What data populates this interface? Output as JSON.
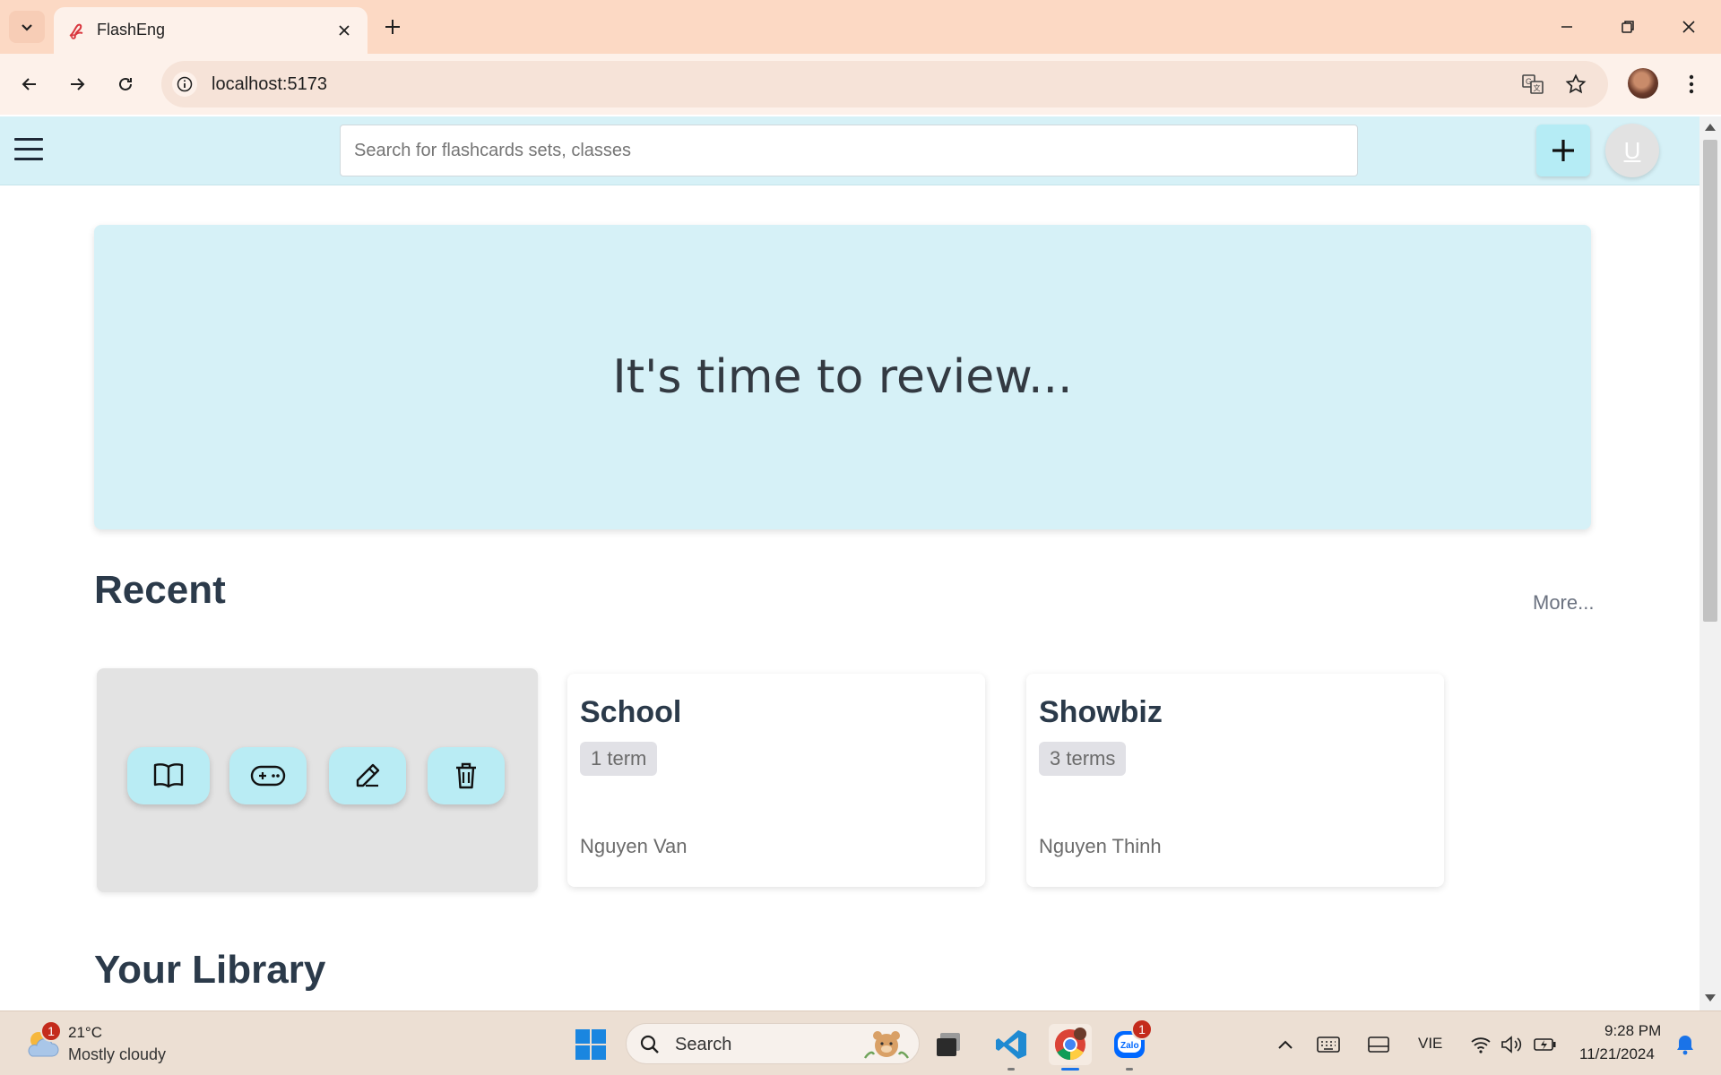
{
  "browser": {
    "tab_title": "FlashEng",
    "url": "localhost:5173"
  },
  "header": {
    "search_placeholder": "Search for flashcards sets, classes",
    "avatar_initial": "U"
  },
  "hero": {
    "text": "It's time to review..."
  },
  "recent": {
    "title": "Recent",
    "more_label": "More...",
    "sets": [
      {
        "title": "School",
        "terms": "1 term",
        "author": "Nguyen Van"
      },
      {
        "title": "Showbiz",
        "terms": "3 terms",
        "author": "Nguyen Thinh"
      }
    ]
  },
  "library": {
    "title": "Your Library"
  },
  "taskbar": {
    "weather_badge": "1",
    "temperature": "21°C",
    "weather": "Mostly cloudy",
    "search_label": "Search",
    "zalo_badge": "1",
    "language": "VIE",
    "time": "9:28 PM",
    "date": "11/21/2024"
  },
  "colors": {
    "header_bg": "#d6f1f7",
    "accent_button": "#b5ecf5",
    "titlebar": "#fcd9c4"
  }
}
